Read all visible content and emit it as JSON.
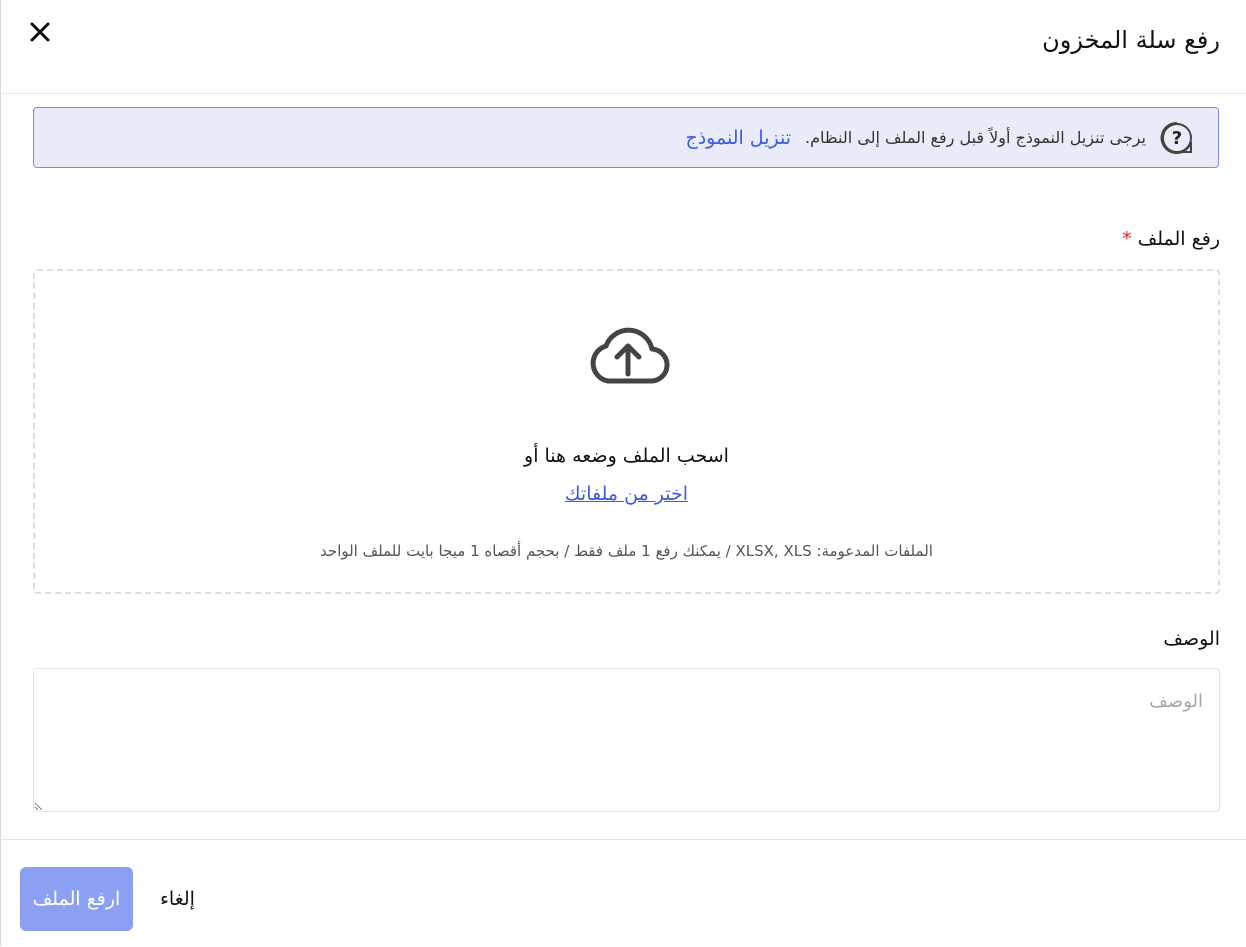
{
  "header": {
    "title": "رفع سلة المخزون"
  },
  "banner": {
    "text": "يرجى تنزيل النموذج أولاً قبل رفع الملف إلى النظام.",
    "link_label": "تنزيل النموذج"
  },
  "upload": {
    "label": "رفع الملف",
    "required_mark": "*",
    "drop_text": "اسحب الملف وضعه هنا أو",
    "browse_link": "اختر من ملفاتك",
    "hint": "الملفات المدعومة: XLSX, XLS / يمكنك رفع 1 ملف فقط / بحجم أقصاه 1 ميجا بايت للملف الواحد"
  },
  "description": {
    "label": "الوصف",
    "placeholder": "الوصف",
    "value": ""
  },
  "footer": {
    "submit_label": "ارفع الملف",
    "cancel_label": "إلغاء"
  },
  "colors": {
    "accent": "#3d5ae0",
    "banner_bg": "#e9ecf8",
    "banner_border": "#7a8de6",
    "disabled_button": "#8b9ff3",
    "required": "#e02424"
  },
  "icons": {
    "close": "close-icon",
    "help": "question-icon",
    "upload": "cloud-upload-icon"
  }
}
